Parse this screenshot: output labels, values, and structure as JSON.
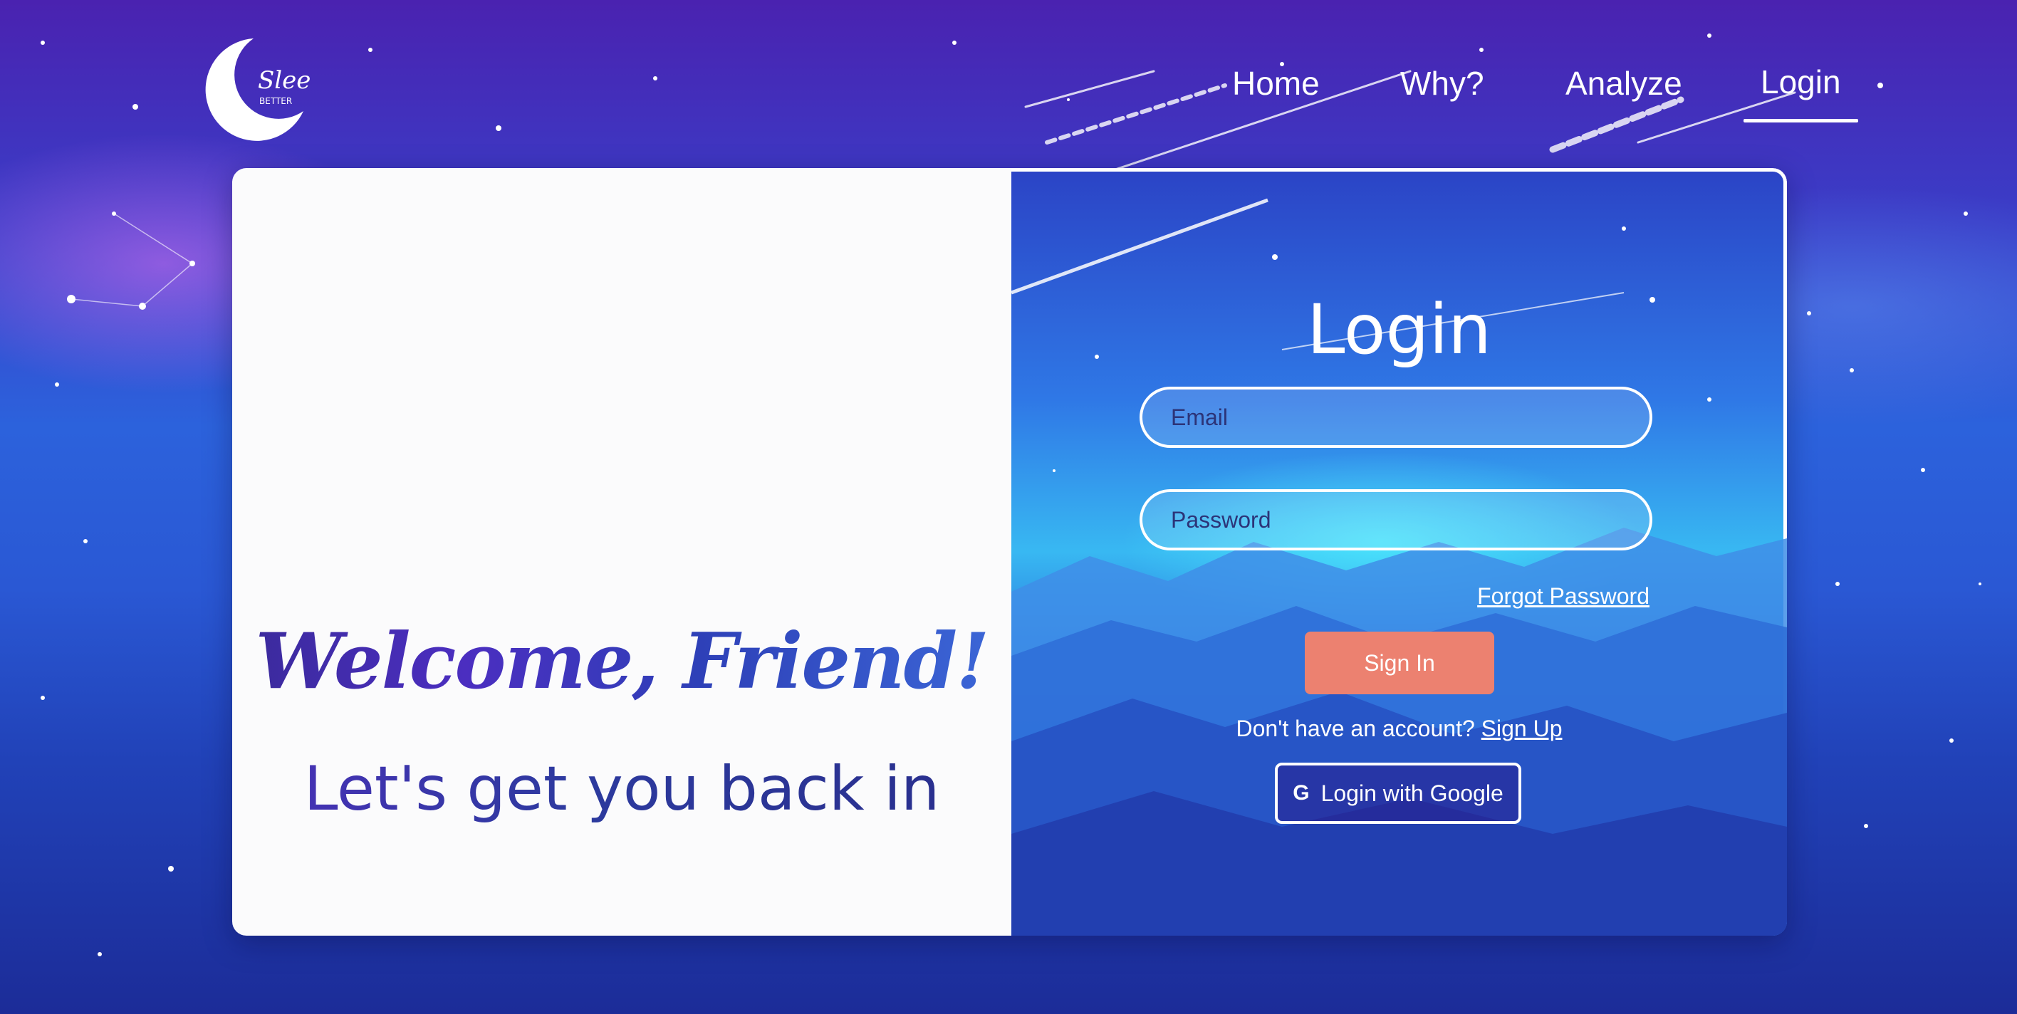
{
  "nav": {
    "logo_text": "Sleep Better",
    "items": [
      {
        "label": "Home",
        "active": false
      },
      {
        "label": "Why?",
        "active": false
      },
      {
        "label": "Analyze",
        "active": false
      },
      {
        "label": "Login",
        "active": true
      }
    ]
  },
  "welcome": {
    "title": "Welcome, Friend!",
    "subtitle": "Let's get you back in"
  },
  "login": {
    "title": "Login",
    "email_placeholder": "Email",
    "password_placeholder": "Password",
    "forgot_label": "Forgot Password",
    "signin_label": "Sign In",
    "no_account_text": "Don't have an account? ",
    "signup_label": "Sign Up",
    "google_icon": "G",
    "google_label": "Login with Google"
  },
  "colors": {
    "accent": "#ec8170",
    "text": "#ffffff",
    "welcome_purple": "#4b2ec0",
    "panel_bg": "#fbfbfc"
  }
}
